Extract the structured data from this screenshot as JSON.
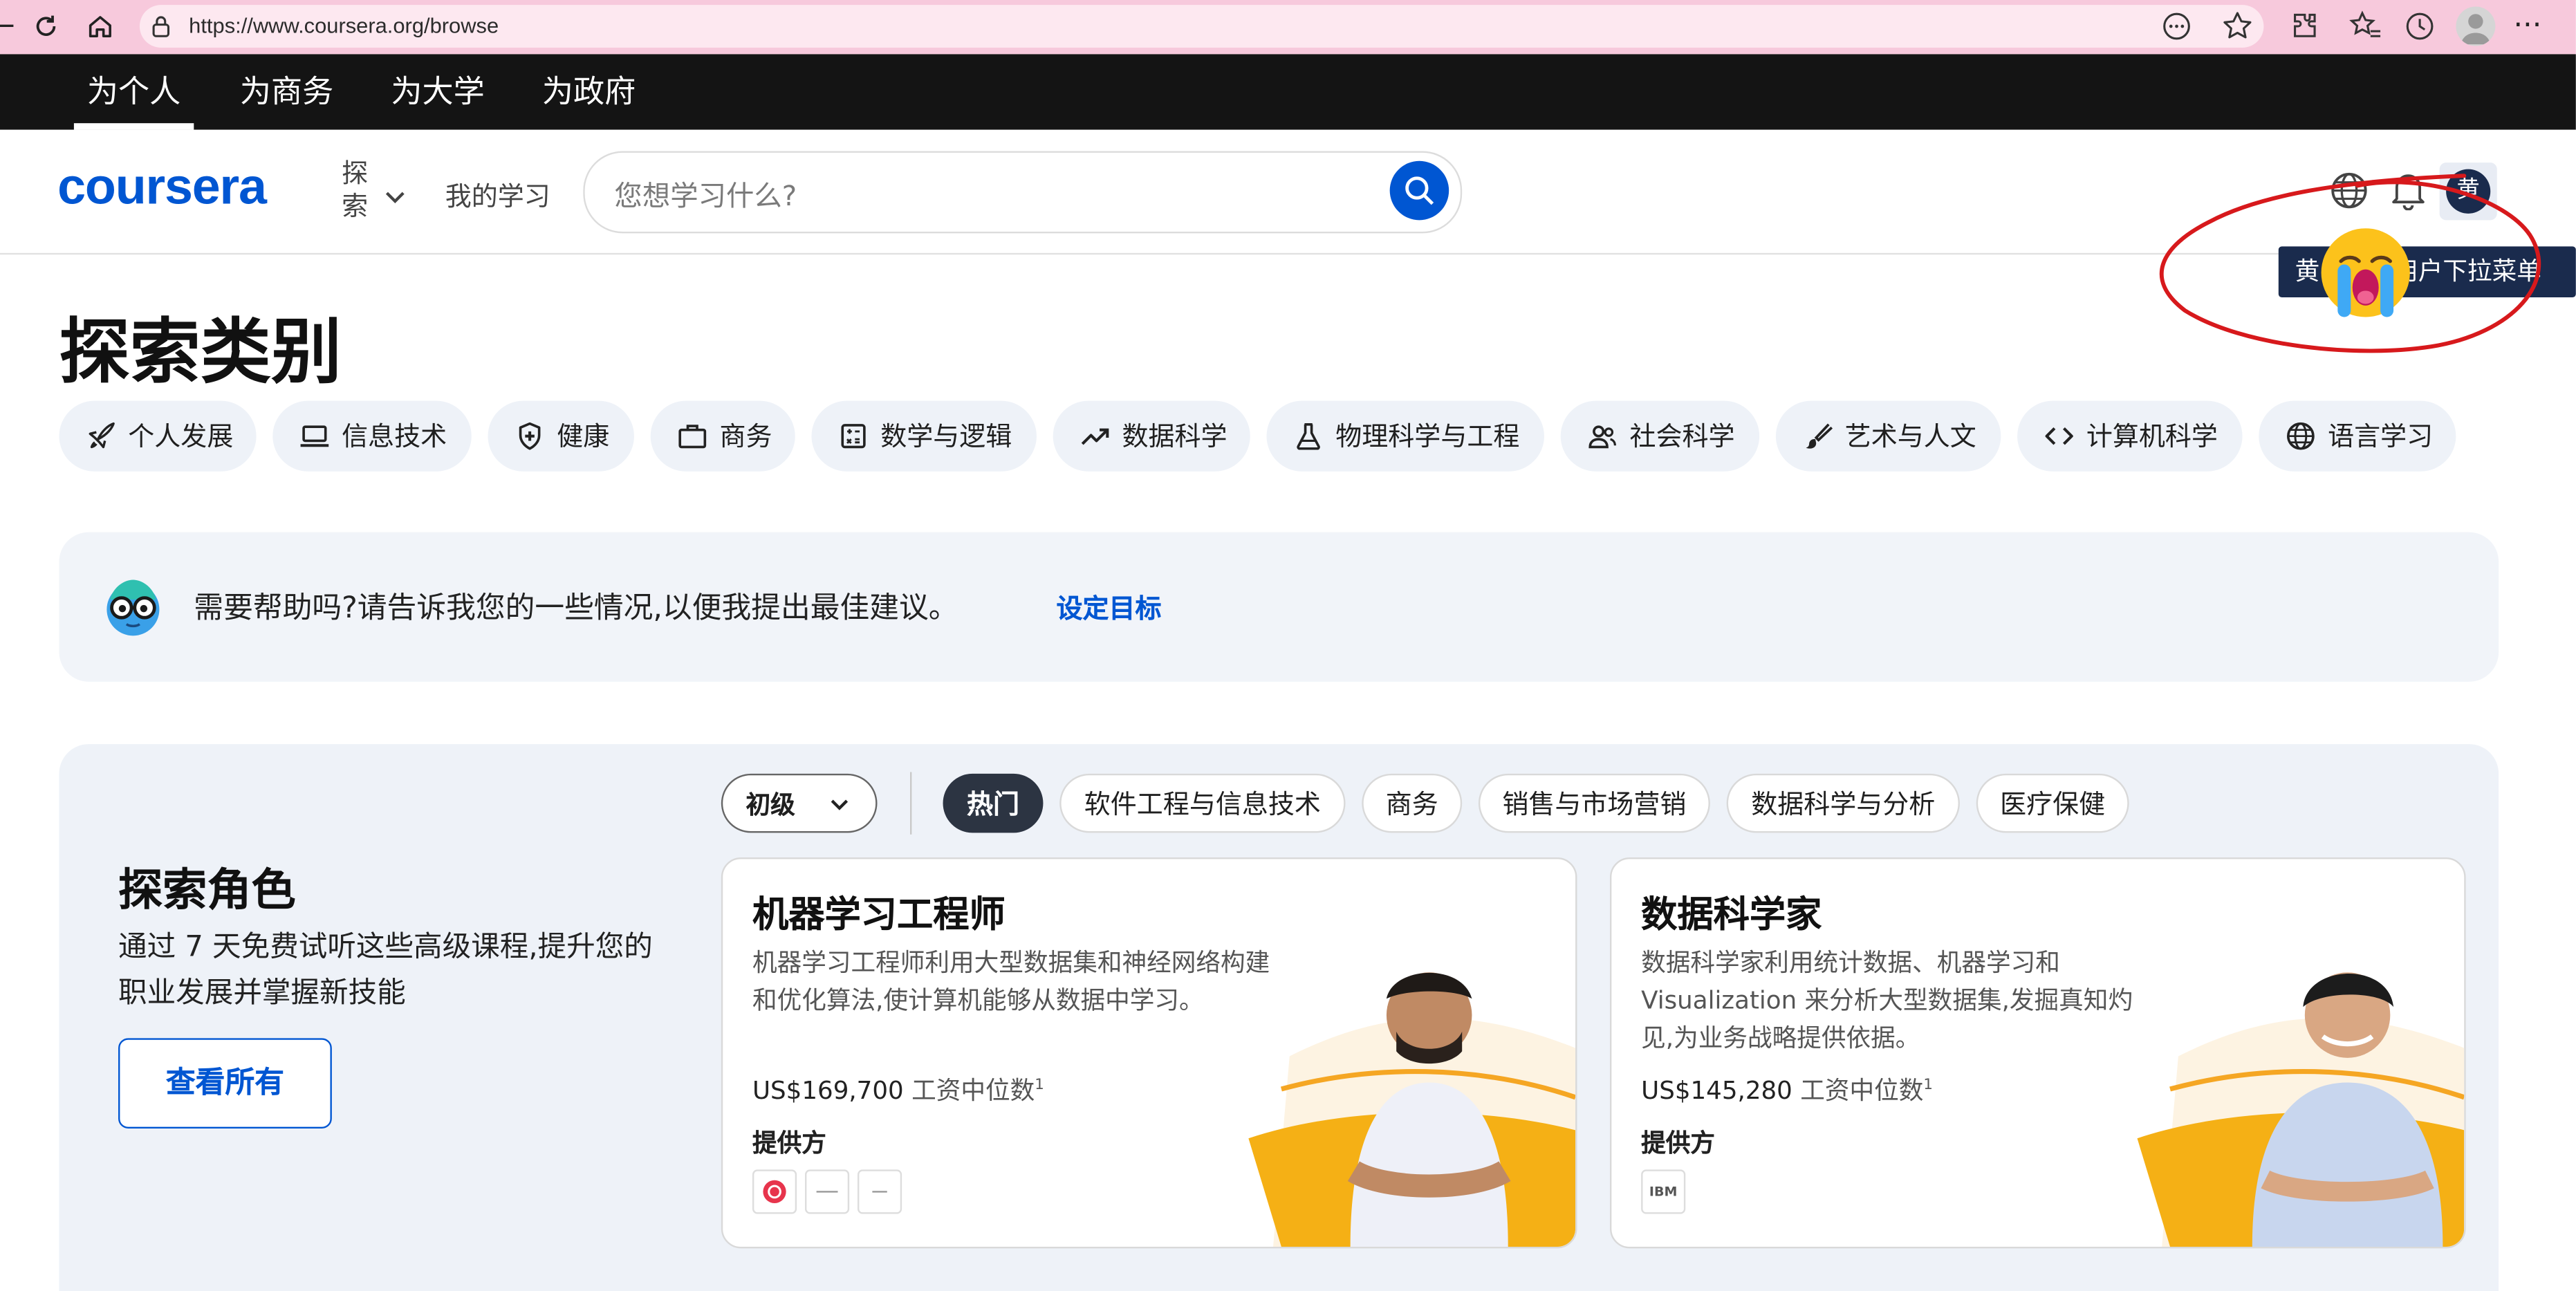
{
  "browser": {
    "url": "https://www.coursera.org/browse"
  },
  "topnav": {
    "items": [
      {
        "label": "为个人"
      },
      {
        "label": "为商务"
      },
      {
        "label": "为大学"
      },
      {
        "label": "为政府"
      }
    ]
  },
  "header": {
    "logo": "coursera",
    "explore_label": "探索",
    "my_learning": "我的学习",
    "search_placeholder": "您想学习什么?",
    "avatar_letter": "黄",
    "tooltip": "黄　　　用户下拉菜单"
  },
  "page": {
    "title": "探索类别"
  },
  "categories": [
    {
      "label": "个人发展",
      "icon": "rocket-icon"
    },
    {
      "label": "信息技术",
      "icon": "laptop-icon"
    },
    {
      "label": "健康",
      "icon": "shield-plus-icon"
    },
    {
      "label": "商务",
      "icon": "briefcase-icon"
    },
    {
      "label": "数学与逻辑",
      "icon": "calculator-icon"
    },
    {
      "label": "数据科学",
      "icon": "trend-up-icon"
    },
    {
      "label": "物理科学与工程",
      "icon": "flask-icon"
    },
    {
      "label": "社会科学",
      "icon": "people-icon"
    },
    {
      "label": "艺术与人文",
      "icon": "brush-icon"
    },
    {
      "label": "计算机科学",
      "icon": "code-icon"
    },
    {
      "label": "语言学习",
      "icon": "globe-icon"
    }
  ],
  "help_banner": {
    "text": "需要帮助吗?请告诉我您的一些情况,以便我提出最佳建议。",
    "link": "设定目标"
  },
  "roles": {
    "title": "探索角色",
    "description": "通过 7 天免费试听这些高级课程,提升您的职业发展并掌握新技能",
    "view_all": "查看所有",
    "level": "初级",
    "filters": [
      {
        "label": "热门",
        "active": true
      },
      {
        "label": "软件工程与信息技术"
      },
      {
        "label": "商务"
      },
      {
        "label": "销售与市场营销"
      },
      {
        "label": "数据科学与分析"
      },
      {
        "label": "医疗保健"
      }
    ],
    "cards": [
      {
        "title": "机器学习工程师",
        "description": "机器学习工程师利用大型数据集和神经网络构建和优化算法,使计算机能够从数据中学习。",
        "salary_value": "US$169,700",
        "salary_label": "工资中位数",
        "salary_note": "1",
        "providers_label": "提供方",
        "providers": [
          "",
          "",
          ""
        ]
      },
      {
        "title": "数据科学家",
        "description": "数据科学家利用统计数据、机器学习和 Visualization 来分析大型数据集,发掘真知灼见,为业务战略提供依据。",
        "salary_value": "US$145,280",
        "salary_label": "工资中位数",
        "salary_note": "1",
        "providers_label": "提供方",
        "providers": [
          "IBM"
        ]
      }
    ]
  },
  "colors": {
    "brand": "#0056d2",
    "annotation": "#d7191c",
    "accent_orange": "#f5a623"
  }
}
